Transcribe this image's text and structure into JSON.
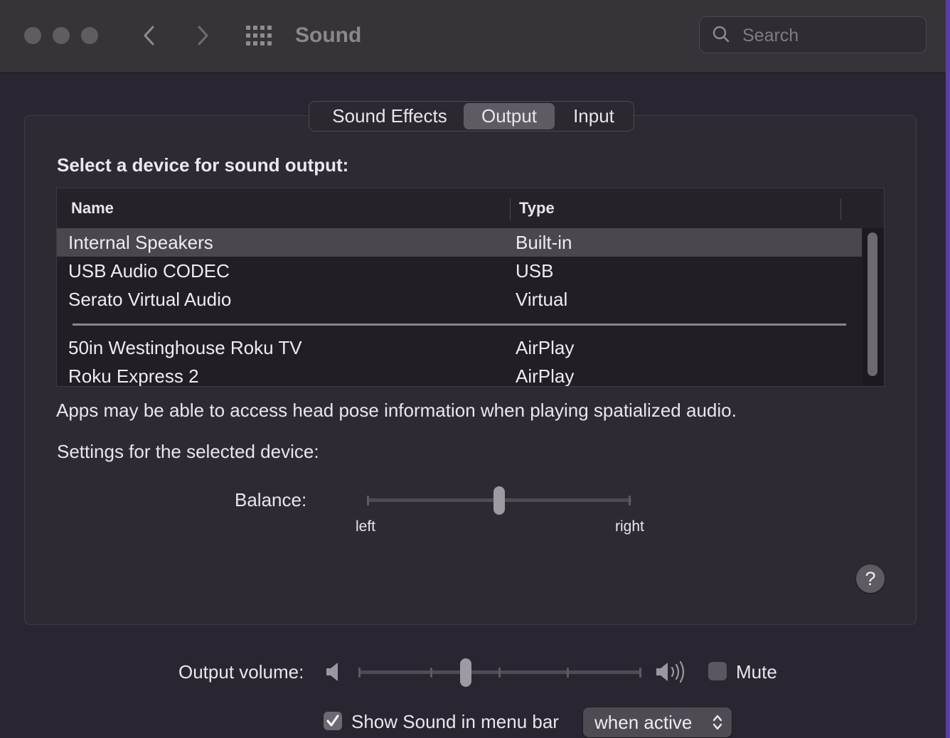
{
  "window": {
    "title": "Sound",
    "search_placeholder": "Search"
  },
  "tabs": [
    {
      "label": "Sound Effects",
      "active": false
    },
    {
      "label": "Output",
      "active": true
    },
    {
      "label": "Input",
      "active": false
    }
  ],
  "output": {
    "heading": "Select a device for sound output:",
    "columns": [
      "Name",
      "Type"
    ],
    "devices": [
      {
        "name": "Internal Speakers",
        "type": "Built-in",
        "selected": true
      },
      {
        "name": "USB Audio CODEC",
        "type": "USB",
        "selected": false
      },
      {
        "name": "Serato Virtual Audio",
        "type": "Virtual",
        "selected": false
      },
      {
        "name": "50in Westinghouse Roku TV",
        "type": "AirPlay",
        "selected": false
      },
      {
        "name": "Roku Express 2",
        "type": "AirPlay",
        "selected": false
      }
    ],
    "info_text": "Apps may be able to access head pose information when playing spatialized audio.",
    "settings_label": "Settings for the selected device:",
    "balance": {
      "label": "Balance:",
      "left_label": "left",
      "right_label": "right",
      "value": 0.5
    }
  },
  "help_symbol": "?",
  "footer": {
    "volume_label": "Output volume:",
    "volume_value": 0.38,
    "mute_label": "Mute",
    "mute_checked": false,
    "show_in_menubar_label": "Show Sound in menu bar",
    "show_in_menubar_checked": true,
    "menubar_option": "when active"
  },
  "colors": {
    "window_bg": "#2a2631",
    "titlebar_bg": "#373439",
    "selected_row": "#4a474e",
    "active_tab": "#5e5b62",
    "desktop_accent": "#5a3fa0"
  }
}
